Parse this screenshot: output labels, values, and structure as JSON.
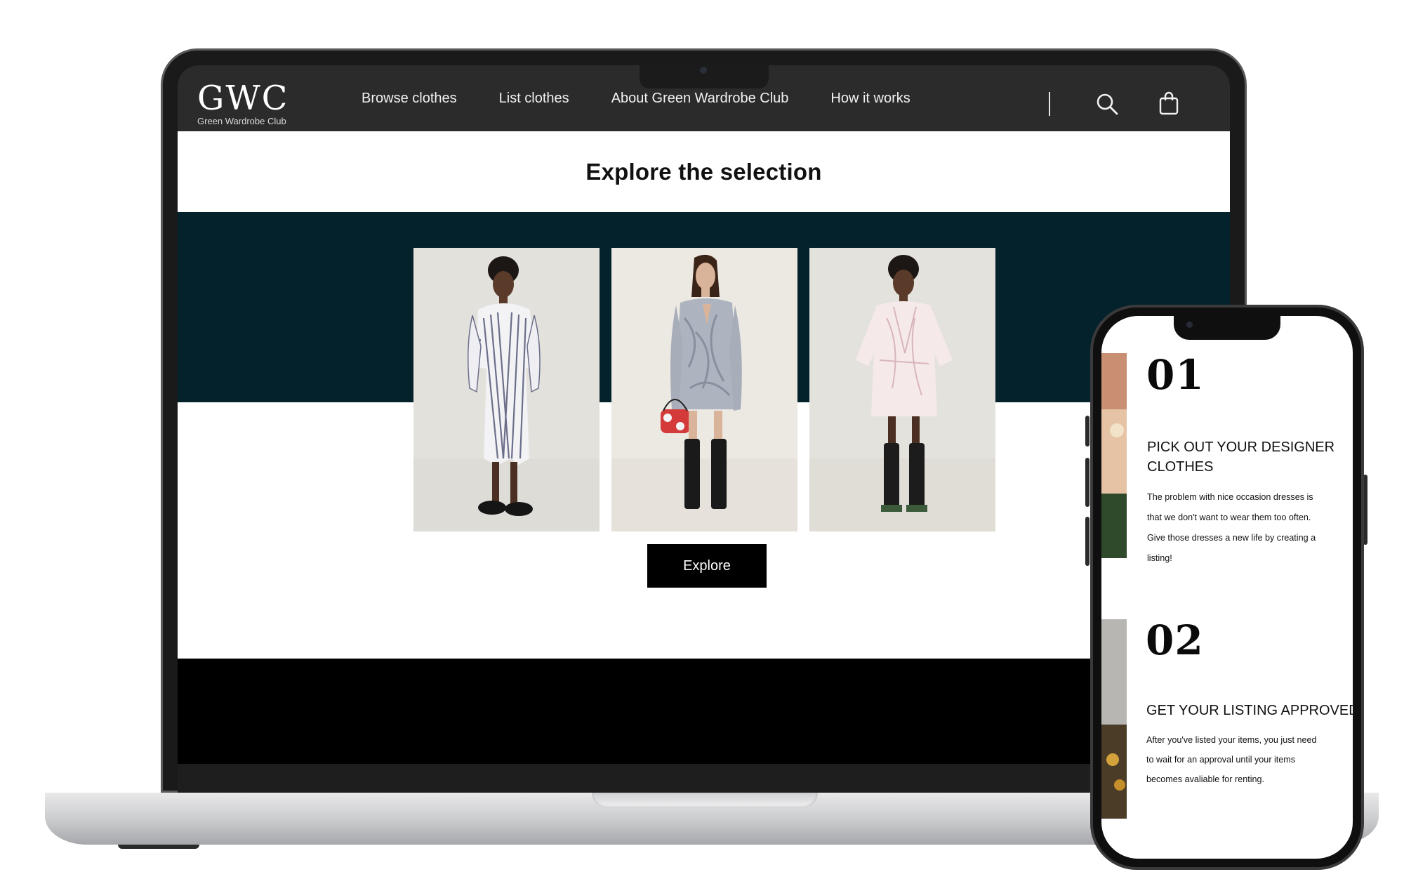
{
  "site": {
    "logo_mark": "GWC",
    "logo_sub": "Green Wardrobe Club"
  },
  "nav": {
    "links": [
      "Browse clothes",
      "List clothes",
      "About Green Wardrobe Club",
      "How it works"
    ],
    "icons": [
      "search-icon",
      "shopping-bag-icon"
    ]
  },
  "main": {
    "title": "Explore the selection",
    "explore_label": "Explore",
    "products": [
      {
        "name": "striped-dress",
        "description_icon": "dress-photo"
      },
      {
        "name": "silver-dress",
        "description_icon": "dress-photo"
      },
      {
        "name": "pink-wrap-dress",
        "description_icon": "dress-photo"
      }
    ]
  },
  "phone": {
    "steps": [
      {
        "number": "01",
        "title_line1": "PICK OUT YOUR DESIGNER",
        "title_line2": "CLOTHES",
        "body_lines": [
          "The problem with nice occasion dresses is",
          "that we don't want to wear them too often.",
          "Give those dresses a new life by creating a",
          "listing!"
        ]
      },
      {
        "number": "02",
        "title_line1": "GET YOUR LISTING APPROVED",
        "body_lines": [
          "After you've listed your items, you just need",
          "to wait for an approval until your items",
          "becomes avaliable for renting."
        ]
      }
    ]
  },
  "colors": {
    "nav_bg": "#2b2b2b",
    "teal_band": "#04222b",
    "button_bg": "#000000"
  }
}
